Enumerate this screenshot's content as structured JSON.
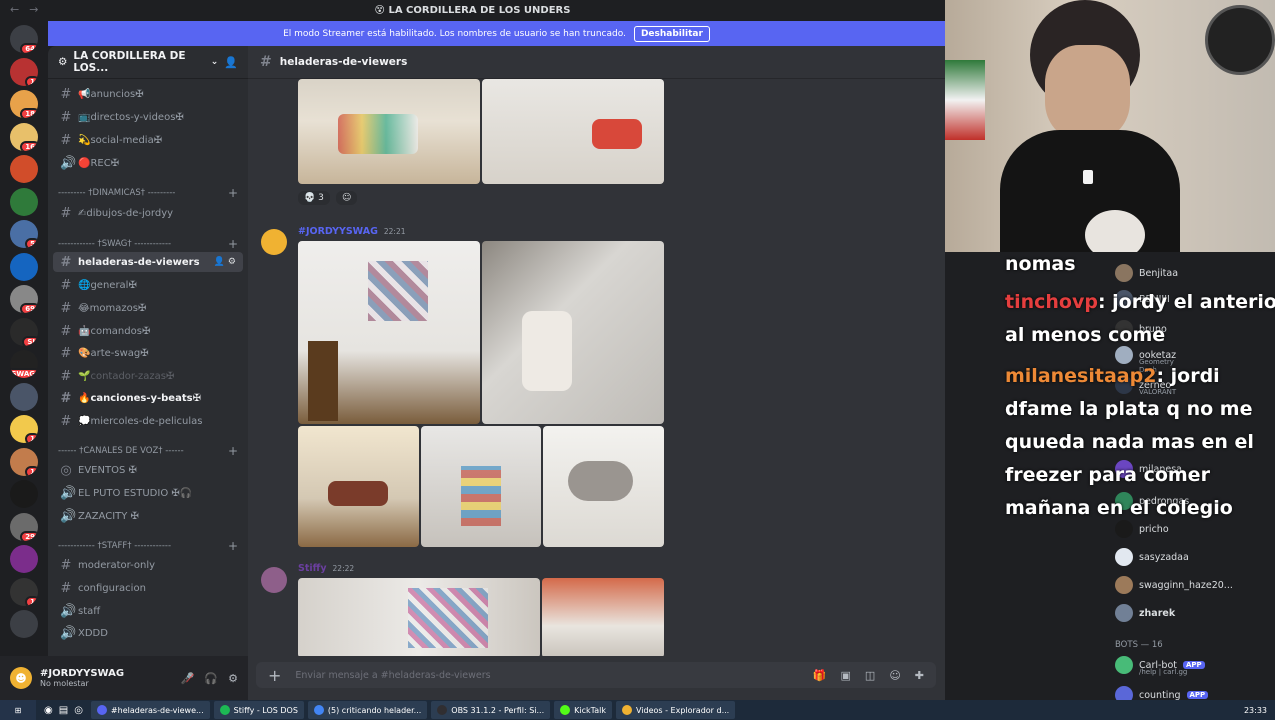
{
  "window": {
    "title": "LA CORDILLERA DE LOS UNDERS"
  },
  "banner": {
    "text": "El modo Streamer está habilitado. Los nombres de usuario se han truncado.",
    "button": "Deshabilitar"
  },
  "server": {
    "name": "LA CORDILLERA DE LOS..."
  },
  "rail_badges": [
    "64",
    "1",
    "18",
    "16",
    "5",
    "69",
    "SI",
    "SWAG",
    "1",
    "1",
    "29",
    "1",
    "1",
    "NUEVO"
  ],
  "categories": [
    {
      "label": "--------- †DINAMICAS† ---------"
    },
    {
      "label": "------------ †SWAG† ------------"
    },
    {
      "label": "------ †CANALES DE VOZ† ------"
    },
    {
      "label": "------------ †STAFF† ------------"
    }
  ],
  "channels": [
    {
      "label": "📢anuncios✠",
      "icon": "hash"
    },
    {
      "label": "📺directos-y-videos✠",
      "icon": "hash"
    },
    {
      "label": "💫social-media✠",
      "icon": "hash"
    },
    {
      "label": "🔴REC✠",
      "icon": "speaker"
    },
    {
      "label": "✍dibujos-de-jordyy",
      "icon": "hash"
    },
    {
      "label": "heladeras-de-viewers",
      "icon": "hash"
    },
    {
      "label": "🌐general✠",
      "icon": "hash"
    },
    {
      "label": "😂momazos✠",
      "icon": "hash"
    },
    {
      "label": "🤖comandos✠",
      "icon": "hash"
    },
    {
      "label": "🎨arte-swag✠",
      "icon": "hash"
    },
    {
      "label": "🌱contador-zazas✠",
      "icon": "hash"
    },
    {
      "label": "🔥canciones-y-beats✠",
      "icon": "hash"
    },
    {
      "label": "💭miercoles-de-peliculas",
      "icon": "hash"
    },
    {
      "label": "EVENTOS ✠",
      "icon": "radio"
    },
    {
      "label": "EL PUTO ESTUDIO ✠🎧",
      "icon": "speaker"
    },
    {
      "label": "ZAZACITY ✠",
      "icon": "speaker"
    },
    {
      "label": "moderator-only",
      "icon": "hash"
    },
    {
      "label": "configuracion",
      "icon": "hash"
    },
    {
      "label": "staff",
      "icon": "speaker"
    },
    {
      "label": "XDDD",
      "icon": "speaker"
    }
  ],
  "user": {
    "name": "#JORDYYSWAG",
    "status": "No molestar"
  },
  "chat": {
    "channel": "heladeras-de-viewers",
    "reaction_count": "3",
    "messages": [
      {
        "author": "#JORDYYSWAG",
        "time": "22:21",
        "color": "#f0b232"
      },
      {
        "author": "Stiffy",
        "time": "22:22",
        "color": "#3ba55d"
      }
    ],
    "composer_placeholder": "Enviar mensaje a #heladeras-de-viewers"
  },
  "stream_chat": {
    "line1": "nomas",
    "user1": "tinchovp",
    "msg1a": ": jordy el anterior",
    "msg1b": "al menos come",
    "user2": "milanesitaap2",
    "msg2a": ": jordi",
    "msg2b": "dfame la plata q no me",
    "msg2c": "quueda nada mas en el",
    "msg2d": "freezer para comer",
    "msg2e": "mañana en el colegio"
  },
  "members": [
    {
      "name": "Benjitaa"
    },
    {
      "name": "BENJIII"
    },
    {
      "name": "bruno"
    },
    {
      "name": "ooketaz",
      "sub": "Geometry Dash"
    },
    {
      "name": "zerneo",
      "sub": "VALORANT"
    },
    {
      "name": "milanesa",
      "sub": ""
    },
    {
      "name": "pedrongas",
      "sub": ""
    },
    {
      "name": "pricho"
    },
    {
      "name": "sasyzadaa"
    },
    {
      "name": "swagginn_haze20..."
    },
    {
      "name": "zharek"
    }
  ],
  "bots_header": "BOTS — 16",
  "bots": [
    {
      "name": "Carl-bot",
      "badge": "APP",
      "sub": "/help | carl.gg"
    },
    {
      "name": "counting",
      "badge": "APP"
    }
  ],
  "taskbar": {
    "items": [
      "#heladeras-de-viewe...",
      "Stiffy - LOS DOS",
      "(5) criticando helader...",
      "OBS 31.1.2 - Perfil: Si...",
      "KickTalk",
      "Videos - Explorador d..."
    ],
    "clock": "23:33"
  }
}
